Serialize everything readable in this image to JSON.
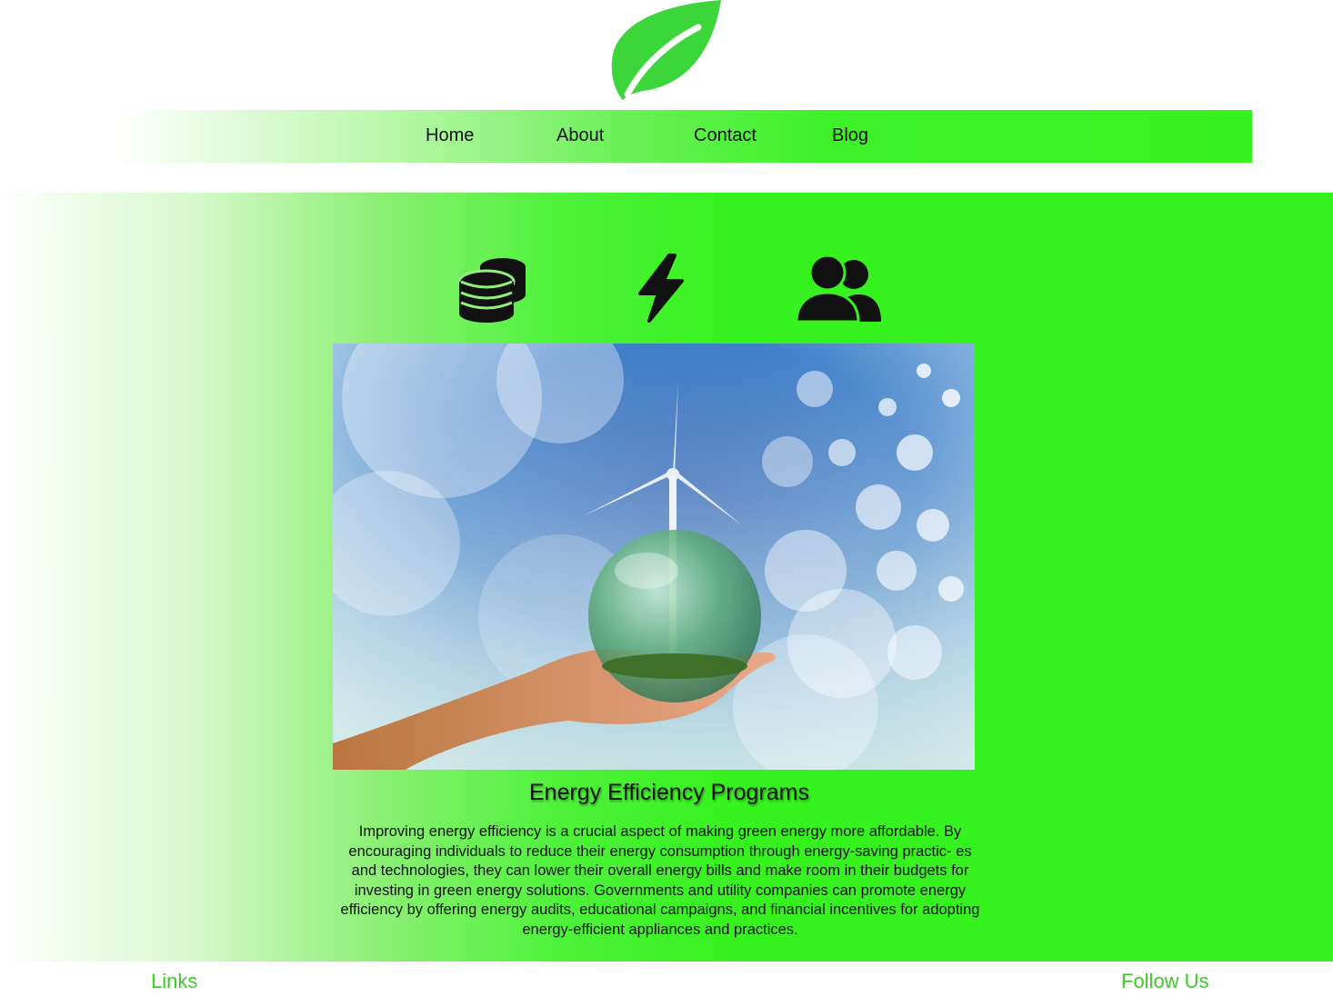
{
  "brand": {
    "logo_icon": "leaf-icon",
    "color": "#3cd63a"
  },
  "nav": {
    "items": [
      {
        "label": "Home"
      },
      {
        "label": "About"
      },
      {
        "label": "Contact"
      },
      {
        "label": "Blog"
      }
    ]
  },
  "features": {
    "icons": [
      "coins-icon",
      "lightning-bolt-icon",
      "users-icon"
    ]
  },
  "article": {
    "title": "Energy Efficiency Programs",
    "body": "Improving energy efficiency is a crucial aspect of making green energy more affordable. By encouraging individuals to reduce their energy consumption through energy-saving practic- es and technologies, they can lower their overall energy bills and make room in their budgets for investing in green energy solutions. Governments and utility companies can promote energy efficiency by offering energy audits, educational campaigns, and financial incentives for adopting energy-efficient appliances and practices."
  },
  "footer": {
    "links_label": "Links",
    "follow_label": "Follow Us"
  },
  "colors": {
    "accent_green": "#36f21e",
    "footer_text": "#3ec92a"
  }
}
